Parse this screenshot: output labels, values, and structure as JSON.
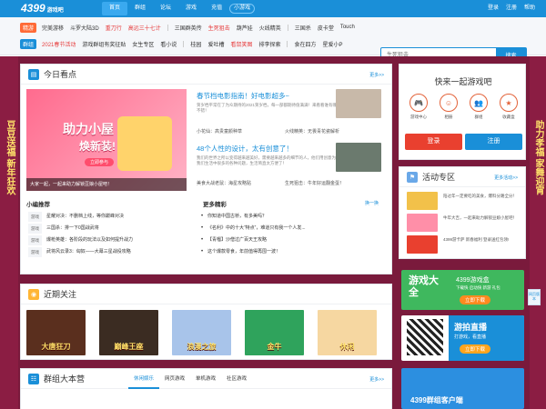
{
  "header": {
    "logo_text": "4399",
    "logo_sub": "游戏吧",
    "nav": [
      {
        "label": "首页",
        "active": true
      },
      {
        "label": "群组"
      },
      {
        "label": "论坛"
      },
      {
        "label": "游戏"
      },
      {
        "label": "充值"
      },
      {
        "label": "小游戏",
        "tag": true
      }
    ],
    "links": [
      "登录",
      "注册",
      "帮助"
    ]
  },
  "subnav": {
    "row1_label": "精游",
    "row1_color": "#ff6a36",
    "row1": [
      {
        "t": "完美游移"
      },
      {
        "t": "斗罗大陆3D"
      },
      {
        "t": "重刀行",
        "red": true
      },
      {
        "t": "高远三十七计",
        "red": true
      },
      {
        "t": "三国群英传"
      },
      {
        "t": "生死狙击",
        "red": true
      },
      {
        "t": "葫芦娃"
      },
      {
        "t": "火线精英"
      },
      {
        "t": "三国杀"
      },
      {
        "t": "皮卡堂"
      },
      {
        "t": "Touch"
      }
    ],
    "row2_label": "群组",
    "row2_color": "#1a8fd8",
    "row2": [
      {
        "t": "2021春节活动",
        "red": true
      },
      {
        "t": "游戏群组有奖征贴"
      },
      {
        "t": "女生专区"
      },
      {
        "t": "看小说"
      },
      {
        "t": "桂园"
      },
      {
        "t": "爱吐槽"
      },
      {
        "t": "看鼠笑图",
        "red": true
      },
      {
        "t": "排李探索"
      },
      {
        "t": "食在四方"
      },
      {
        "t": "星爱小P"
      }
    ],
    "search_placeholder": "生死狙击",
    "search_button": "搜索"
  },
  "side": {
    "left": "豆豆送福 新年狂欢",
    "right": "助力孝福 家舞迎宵"
  },
  "today": {
    "title": "今日看点",
    "more": "更多>>",
    "banner_text": "助力小屋",
    "banner_text2": "焕新装!",
    "banner_pill": "立即参与",
    "caption": "大家一起，一起来助力解锁豆娘小屋吧！",
    "news": [
      {
        "title": "春节档电影指南！好电影超多~",
        "desc": "贺岁档平常在了为众期待的2021贺岁档，每一部都期待值满满！来看看谁有哪些好片不错！"
      },
      {
        "title": "48个人性的设计，太有创意了！",
        "desc": "我们的世界之所以变得越来越美好，需要越来越多的细节的人，他们用创意为解决了我们生活中很多的各种问题，生活简直太方便了！"
      }
    ],
    "hl": [
      {
        "a": "小花仙：高贵童颜种草",
        "b": "火线精英：无畏青花瓷解析"
      },
      {
        "a": "美食大战老鼠：海星攻略贴",
        "b": "生死狙击：牛年好运翻金蛋！"
      }
    ],
    "sub1": "小编推荐",
    "sub2": "更多精彩",
    "sub2_more": "换一换",
    "list1": [
      {
        "tag": "游戏",
        "t": "星耀对决：不删档上线，等你巅峰对决"
      },
      {
        "tag": "游戏",
        "t": "三国杀：排一下0国战武将"
      },
      {
        "tag": "游戏",
        "t": "爆枪英雄：各阶段的玩法以及如何提升战力"
      },
      {
        "tag": "游戏",
        "t": "武将风云录3：匈奴——大幕三星战役攻略"
      }
    ],
    "list2": [
      "你知道中国古桥，有多美吗？",
      "《名利》中的十大“特点”，难道只有我一个人发...",
      "【青榴】沙僧过广百天王攻略",
      "这个爆款零食，年前值得再囤一波！"
    ]
  },
  "recent": {
    "title": "近期关注",
    "items": [
      {
        "label": "大唐狂刀",
        "color": "#5a2f1e"
      },
      {
        "label": "巅峰王座",
        "color": "#3b2c22"
      },
      {
        "label": "浪漫之旅",
        "color": "#a8c4ea"
      },
      {
        "label": "金牛",
        "color": "#2fa35c"
      },
      {
        "label": "休闲",
        "color": "#f6d7a1"
      }
    ]
  },
  "groups": {
    "title": "群组大本营",
    "more": "更多>>",
    "tabs": [
      "休闲娱乐",
      "网页游戏",
      "单机游戏",
      "社区游戏"
    ]
  },
  "login": {
    "title": "快来一起游戏吧",
    "icons": [
      {
        "label": "游戏中心",
        "g": "🎮"
      },
      {
        "label": "相册",
        "g": "☺"
      },
      {
        "label": "群组",
        "g": "👥"
      },
      {
        "label": "收藏盒",
        "g": "★"
      }
    ],
    "login_btn": "登录",
    "register_btn": "注册"
  },
  "activity": {
    "title": "活动专区",
    "more": "更多活动>>",
    "items": [
      {
        "t": "陪过年一定要吃的美食，爆料分路全分！",
        "color": "#f2c14a"
      },
      {
        "t": "牛年大吉，一起来助力解锁豆娘小屋吧！",
        "color": "#ff8fa8"
      },
      {
        "t": "4399游卡萨 新春福利 登录送红包领!",
        "color": "#e9402f"
      }
    ]
  },
  "ads": [
    {
      "title": "游戏大全",
      "sub": "4399游戏盒",
      "line": "下载快 启动快 新游 礼包",
      "btn": "立即下载",
      "color": "#4cc364"
    },
    {
      "title": "游拍直播",
      "sub": "打游戏，看直播",
      "line": "",
      "btn": "立即下载",
      "color": "#1a8fd8"
    },
    {
      "title": "4399群组客户端",
      "sub": "",
      "line": "",
      "btn": "",
      "color": "#1a8fd8"
    }
  ],
  "float_badge": "网页版本",
  "fav_tag": "收藏",
  "colors": {
    "brand": "#1a8fd8",
    "accent": "#e9402f",
    "bg": "#7a1a3c"
  }
}
